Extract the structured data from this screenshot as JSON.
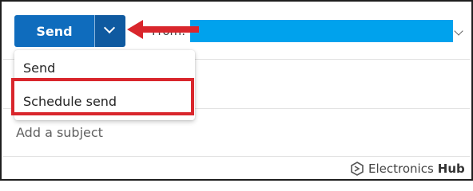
{
  "compose": {
    "send_button_label": "Send",
    "from_label": "From: o",
    "subject_placeholder": "Add a subject"
  },
  "send_menu": {
    "items": [
      {
        "label": "Send"
      },
      {
        "label": "Schedule send"
      }
    ]
  },
  "watermark": {
    "brand_regular": "Electronics",
    "brand_bold": "Hub"
  },
  "colors": {
    "send_button": "#0f6cbd",
    "annotation": "#d9262c",
    "redaction": "#00a2ed"
  }
}
